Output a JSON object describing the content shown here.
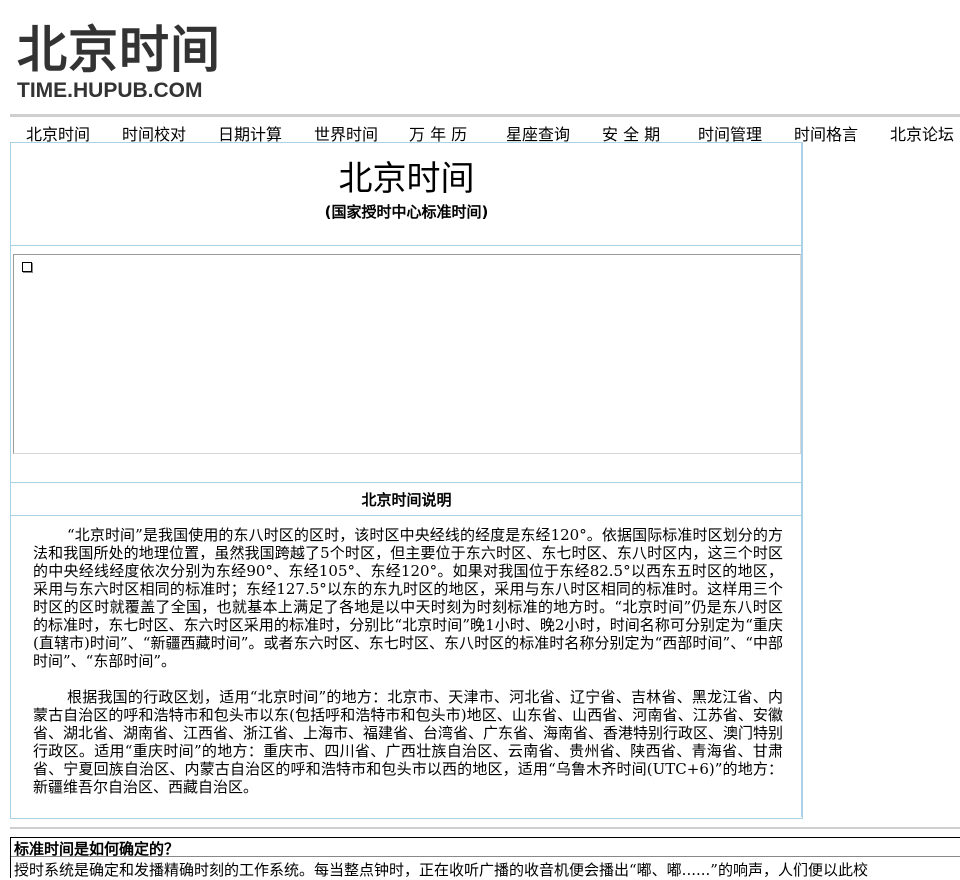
{
  "logo": {
    "cn": "北京时间",
    "en": "TIME.HUPUB.COM"
  },
  "nav": [
    {
      "label": "北京时间"
    },
    {
      "label": "时间校对"
    },
    {
      "label": "日期计算"
    },
    {
      "label": "世界时间"
    },
    {
      "label": "万 年 历"
    },
    {
      "label": "星座查询"
    },
    {
      "label": "安 全 期"
    },
    {
      "label": "时间管理"
    },
    {
      "label": "时间格言"
    },
    {
      "label": "北京论坛"
    }
  ],
  "main": {
    "title": "北京时间",
    "subtitle": "(国家授时中心标准时间)",
    "frame_icon": "broken-image-icon",
    "section_title": "北京时间说明",
    "paragraphs": [
      "“北京时间”是我国使用的东八时区的区时，该时区中央经线的经度是东经120°。依据国际标准时区划分的方法和我国所处的地理位置，虽然我国跨越了5个时区，但主要位于东六时区、东七时区、东八时区内，这三个时区的中央经线经度依次分别为东经90°、东经105°、东经120°。如果对我国位于东经82.5°以西东五时区的地区，采用与东六时区相同的标准时；东经127.5°以东的东九时区的地区，采用与东八时区相同的标准时。这样用三个时区的区时就覆盖了全国，也就基本上满足了各地是以中天时刻为时刻标准的地方时。“北京时间”仍是东八时区的标准时，东七时区、东六时区采用的标准时，分别比“北京时间”晚1小时、晚2小时，时间名称可分别定为“重庆(直辖市)时间”、“新疆西藏时间”。或者东六时区、东七时区、东八时区的标准时名称分别定为“西部时间”、“中部时间”、“东部时间”。",
      "根据我国的行政区划，适用“北京时间”的地方：北京市、天津市、河北省、辽宁省、吉林省、黑龙江省、内蒙古自治区的呼和浩特市和包头市以东(包括呼和浩特市和包头市)地区、山东省、山西省、河南省、江苏省、安徽省、湖北省、湖南省、江西省、浙江省、上海市、福建省、台湾省、广东省、海南省、香港特别行政区、澳门特别行政区。适用“重庆时间”的地方：重庆市、四川省、广西壮族自治区、云南省、贵州省、陕西省、青海省、甘肃省、宁夏回族自治区、内蒙古自治区的呼和浩特市和包头市以西的地区，适用“乌鲁木齐时间(UTC+6)”的地方：新疆维吾尔自治区、西藏自治区。"
    ]
  },
  "bottom": {
    "title": "标准时间是如何确定的？",
    "text": "授时系统是确定和发播精确时刻的工作系统。每当整点钟时，正在收听广播的收音机便会播出“嘟、嘟......”的响声，人们便以此校"
  },
  "colors": {
    "border": "#a9d2e6",
    "separator": "#cfcfcf"
  }
}
